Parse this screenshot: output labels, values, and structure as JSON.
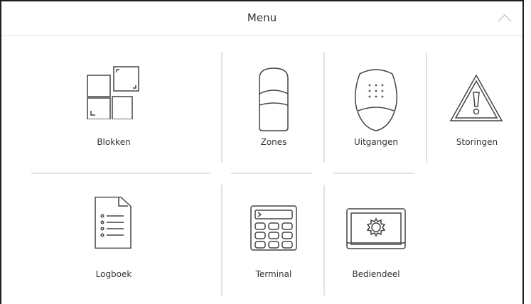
{
  "menu": {
    "title": "Menu"
  },
  "tiles": [
    {
      "label": "Blokken",
      "icon": "blocks-icon"
    },
    {
      "label": "Zones",
      "icon": "zone-detector-icon"
    },
    {
      "label": "Uitgangen",
      "icon": "outputs-siren-icon"
    },
    {
      "label": "Storingen",
      "icon": "warning-triangle-icon"
    },
    {
      "label": "Logboek",
      "icon": "log-document-icon"
    },
    {
      "label": "Terminal",
      "icon": "keypad-terminal-icon"
    },
    {
      "label": "Bediendeel",
      "icon": "control-panel-gear-icon"
    }
  ]
}
